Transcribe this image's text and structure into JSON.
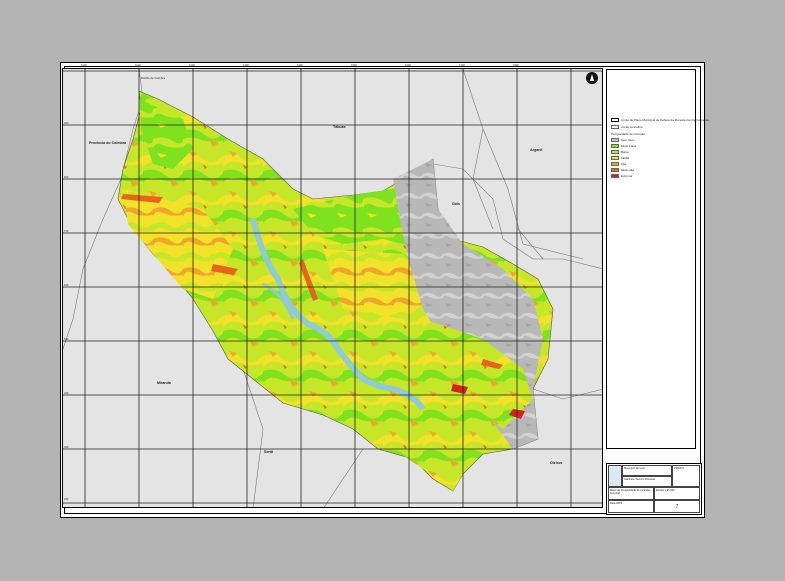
{
  "map": {
    "place_labels": {
      "top_left_small": "Distrito de Coimbra",
      "left": "Provincia do Coimbra",
      "top_center": "Tábuas",
      "right_top": "Arganil",
      "center_right": "Góis",
      "bottom_left": "Miranda",
      "bottom_center": "Sertã",
      "bottom_right": "Oleiros"
    },
    "grid_ticks_top": [
      "1000",
      "1100",
      "1200",
      "1300",
      "1400",
      "1500",
      "1600",
      "1700",
      "1800"
    ],
    "grid_ticks_left": [
      "900",
      "800",
      "700",
      "600",
      "500",
      "400",
      "300",
      "200"
    ],
    "north_arrow": "north-arrow-icon"
  },
  "legend": {
    "items": [
      {
        "label": "Limite do Plano Municipal de Defesa da Floresta Contra Incêndios",
        "color": "#ffffff"
      },
      {
        "label": "Limite concelhio",
        "color": "#ffffff"
      },
      {
        "label": "Perigosidade de incêndio",
        "color": "#ffffff"
      },
      {
        "label": "Sem risco",
        "color": "#c8c8c8"
      },
      {
        "label": "Muito baixa",
        "color": "#7ee21e"
      },
      {
        "label": "Baixa",
        "color": "#c6e628"
      },
      {
        "label": "Média",
        "color": "#f3e22a"
      },
      {
        "label": "Alta",
        "color": "#f0a62a"
      },
      {
        "label": "Muito alta",
        "color": "#e8641c"
      },
      {
        "label": "Extrema",
        "color": "#d8201a"
      }
    ]
  },
  "titleblock": {
    "org": "Município de Góis",
    "dept": "Gabinete Técnico Florestal",
    "title": "Mapa de Perigosidade de Incêndio Florestal",
    "subtitle": "PMDFCI",
    "scale_label": "Escala",
    "scale_value": "1:25 000",
    "date_label": "Data",
    "date_value": "2015",
    "map_no": "7"
  },
  "colors": {
    "green": "#7ee21e",
    "yellowgreen": "#c6e628",
    "yellow": "#f3e22a",
    "orange": "#f0a62a",
    "red": "#d8201a",
    "gray": "#c8c8c8",
    "water": "#8ecad8"
  }
}
